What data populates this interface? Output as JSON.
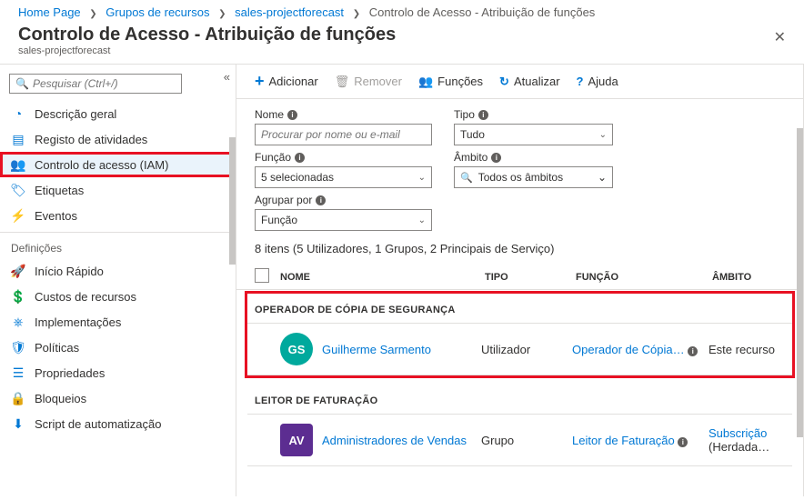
{
  "breadcrumb": {
    "home": "Home Page",
    "rg": "Grupos de recursos",
    "project": "sales-projectforecast",
    "current": "Controlo de Acesso - Atribuição de funções"
  },
  "title": "Controlo de Acesso - Atribuição de funções",
  "subtitle": "sales-projectforecast",
  "search_placeholder": "Pesquisar (Ctrl+/)",
  "nav": {
    "overview": "Descrição geral",
    "activity": "Registo de atividades",
    "iam": "Controlo de acesso (IAM)",
    "tags": "Etiquetas",
    "events": "Eventos",
    "section": "Definições",
    "quickstart": "Início Rápido",
    "costs": "Custos de recursos",
    "deployments": "Implementações",
    "policies": "Políticas",
    "properties": "Propriedades",
    "locks": "Bloqueios",
    "automation": "Script de automatização"
  },
  "toolbar": {
    "add": "Adicionar",
    "remove": "Remover",
    "roles": "Funções",
    "refresh": "Atualizar",
    "help": "Ajuda"
  },
  "filters": {
    "name_label": "Nome",
    "name_placeholder": "Procurar por nome ou e-mail",
    "type_label": "Tipo",
    "type_value": "Tudo",
    "role_label": "Função",
    "role_value": "5 selecionadas",
    "scope_label": "Âmbito",
    "scope_value": "Todos os âmbitos",
    "groupby_label": "Agrupar por",
    "groupby_value": "Função"
  },
  "count": "8 itens (5 Utilizadores, 1 Grupos, 2 Principais de Serviço)",
  "columns": {
    "name": "NOME",
    "type": "TIPO",
    "role": "FUNÇÃO",
    "scope": "ÂMBITO"
  },
  "groups": [
    {
      "header": "OPERADOR DE CÓPIA DE SEGURANÇA",
      "highlighted": true,
      "row": {
        "initials": "GS",
        "avatar_class": "av-gs",
        "name": "Guilherme Sarmento",
        "type": "Utilizador",
        "role": "Operador de Cópia…",
        "scope": "Este recurso"
      }
    },
    {
      "header": "LEITOR DE FATURAÇÃO",
      "highlighted": false,
      "row": {
        "initials": "AV",
        "avatar_class": "av-av",
        "name": "Administradores de Vendas",
        "type": "Grupo",
        "role": "Leitor de Faturação",
        "scope_link": "Subscrição",
        "scope_suffix": " (Herdada…"
      }
    }
  ]
}
